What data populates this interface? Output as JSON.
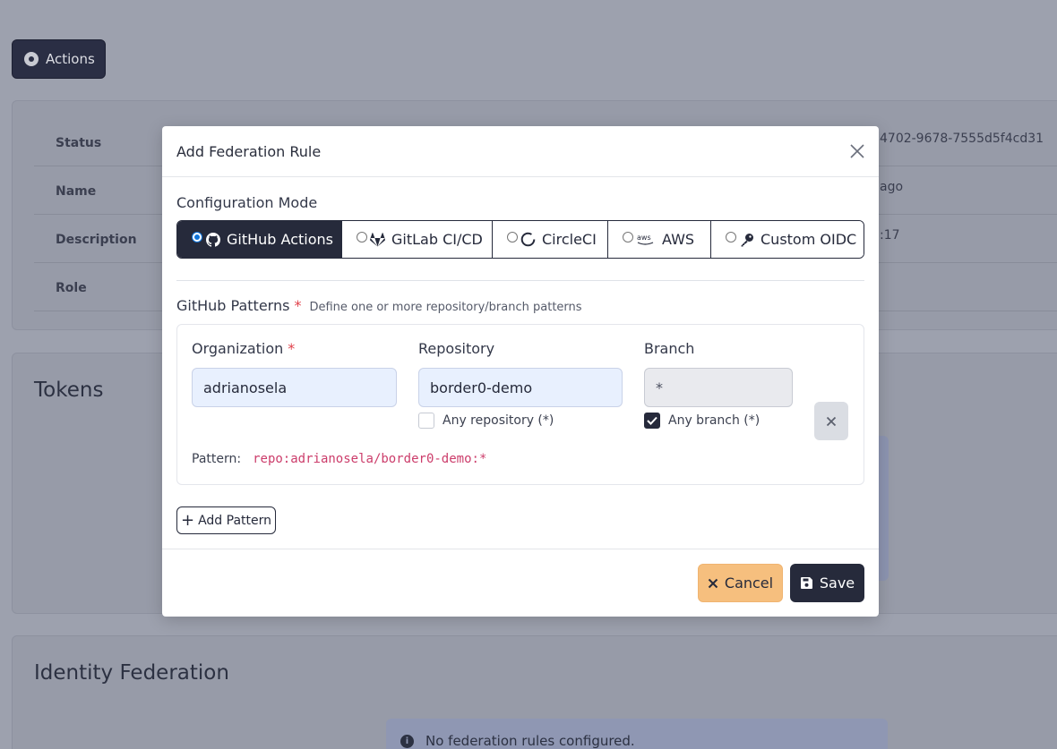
{
  "background": {
    "actions_label": "Actions",
    "details": [
      {
        "label": "Status",
        "value": "4702-9678-7555d5f4cd31"
      },
      {
        "label": "Name",
        "value": "ago"
      },
      {
        "label": "Description",
        "value": ":17"
      },
      {
        "label": "Role",
        "value": ""
      }
    ],
    "tokens_title": "Tokens",
    "identity_title": "Identity Federation",
    "alert_text": "No federation rules configured."
  },
  "modal": {
    "title": "Add Federation Rule",
    "config_mode_label": "Configuration Mode",
    "modes": [
      {
        "label": "GitHub Actions",
        "icon": "github-icon",
        "selected": true
      },
      {
        "label": "GitLab CI/CD",
        "icon": "gitlab-icon",
        "selected": false
      },
      {
        "label": "CircleCI",
        "icon": "circleci-icon",
        "selected": false
      },
      {
        "label": "AWS",
        "icon": "aws-icon",
        "selected": false
      },
      {
        "label": "Custom OIDC",
        "icon": "key-icon",
        "selected": false
      }
    ],
    "patterns": {
      "title": "GitHub Patterns",
      "required_mark": "*",
      "hint": "Define one or more repository/branch patterns",
      "organization_label": "Organization",
      "organization_value": "adrianosela",
      "repository_label": "Repository",
      "repository_value": "border0-demo",
      "any_repository_label": "Any repository (*)",
      "any_repository_checked": false,
      "branch_label": "Branch",
      "branch_value": "*",
      "any_branch_label": "Any branch (*)",
      "any_branch_checked": true,
      "pattern_label": "Pattern:",
      "pattern_value": "repo:adrianosela/border0-demo:*"
    },
    "add_pattern_label": "Add Pattern",
    "cancel_label": "Cancel",
    "save_label": "Save"
  },
  "colors": {
    "primary": "#262a3b",
    "cancel": "#f6bf7e",
    "required": "#e0424b",
    "code": "#cc3d6b",
    "radio_selected": "#0f73d9"
  }
}
